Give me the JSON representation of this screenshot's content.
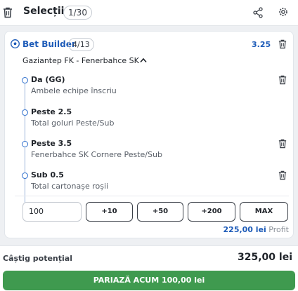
{
  "header": {
    "title": "Selecții",
    "count": "1/30",
    "icons": [
      "trash-icon",
      "share-icon",
      "gear-icon"
    ]
  },
  "bet_builder": {
    "title": "Bet Builder",
    "count": "4/13",
    "odds": "3.25",
    "match": "Gaziantep FK - Fenerbahce SK",
    "selections": [
      {
        "name": "Da (GG)",
        "market": "Ambele echipe înscriu"
      },
      {
        "name": "Peste 2.5",
        "market": "Total goluri Peste/Sub"
      },
      {
        "name": "Peste 3.5",
        "market": "Fenerbahce SK Cornere Peste/Sub"
      },
      {
        "name": "Sub 0.5",
        "market": "Total cartonașe roșii"
      }
    ]
  },
  "stake": {
    "value": "100",
    "quick_buttons": [
      "+10",
      "+50",
      "+200",
      "MAX"
    ],
    "profit_value": "225,00 lei",
    "profit_label": "Profit"
  },
  "footer": {
    "potential_win_label": "Câștig potențial",
    "potential_win_value": "325,00 lei",
    "place_bet_label": "PARIAZĂ ACUM 100,00 lei"
  },
  "colors": {
    "accent_blue": "#1d5bb8",
    "place_bet_green": "#3f9a4f"
  }
}
